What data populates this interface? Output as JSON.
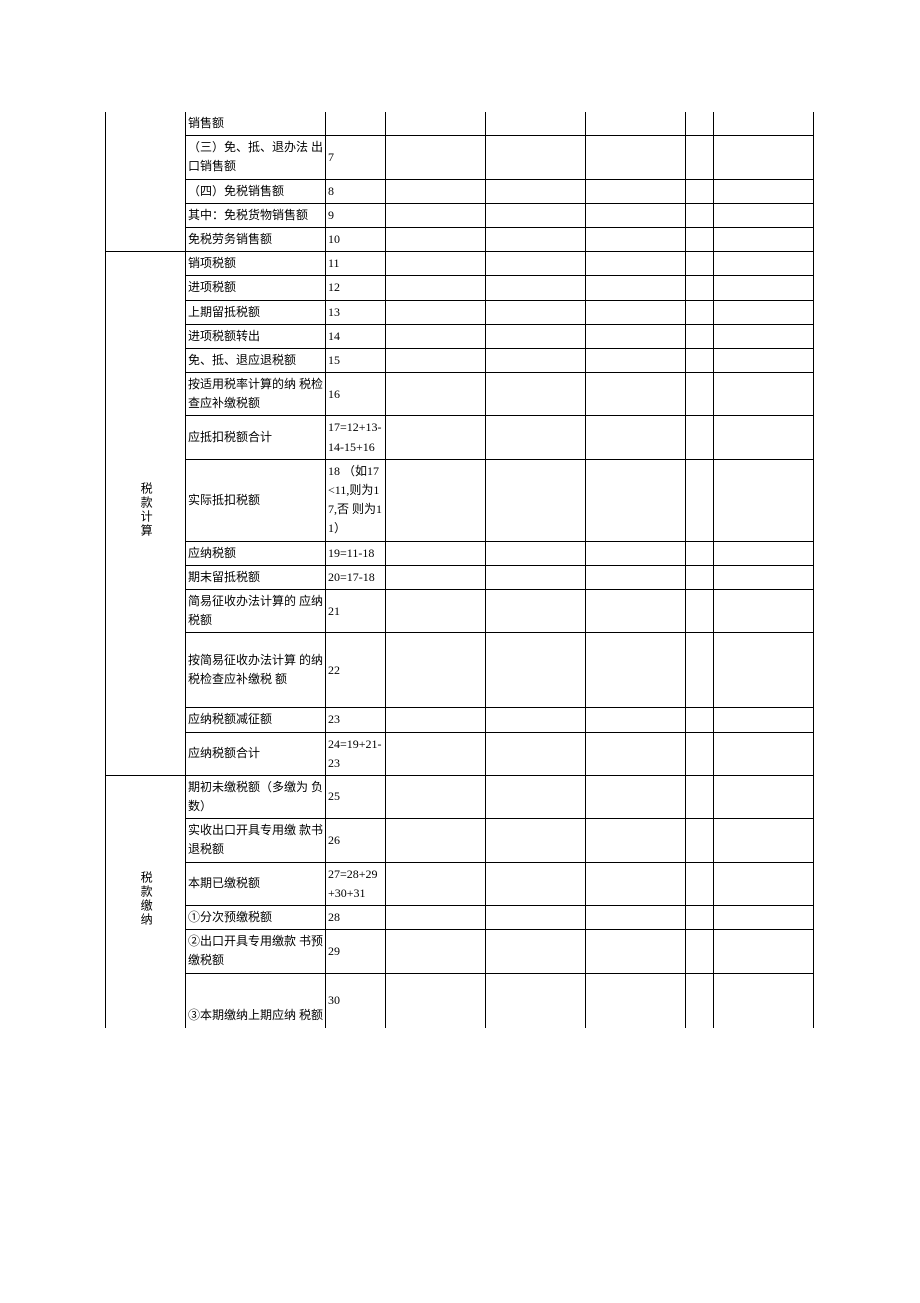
{
  "sections": {
    "top": [
      {
        "desc": "销售额",
        "num": ""
      },
      {
        "desc": " （三）免、抵、退办法 出口销售额",
        "num": "7"
      },
      {
        "desc": " （四）免税销售额",
        "num": "8"
      },
      {
        "desc": "其中：免税货物销售额",
        "num": "9"
      },
      {
        "desc": "免税劳务销售额",
        "num": "10"
      }
    ],
    "calc_label": "税款计算",
    "calc": [
      {
        "desc": "销项税额",
        "num": "11"
      },
      {
        "desc": "进项税额",
        "num": "12"
      },
      {
        "desc": "上期留抵税额",
        "num": "13"
      },
      {
        "desc": "进项税额转出",
        "num": "14"
      },
      {
        "desc": "免、抵、退应退税额",
        "num": "15"
      },
      {
        "desc": "按适用税率计算的纳 税检查应补缴税额",
        "num": "16"
      },
      {
        "desc": "应抵扣税额合计",
        "num": "17=12+13-14-15+16"
      },
      {
        "desc": "实际抵扣税额",
        "num": "18 （如17<11,则为17,否 则为11）"
      },
      {
        "desc": "应纳税额",
        "num": "19=11-18"
      },
      {
        "desc": "期末留抵税额",
        "num": "20=17-18"
      },
      {
        "desc": "简易征收办法计算的 应纳税额",
        "num": "21"
      },
      {
        "desc": "按简易征收办法计算 的纳税检查应补缴税 额",
        "num": "22"
      },
      {
        "desc": "应纳税额减征额",
        "num": "23"
      },
      {
        "desc": "应纳税额合计",
        "num": "24=19+21-23"
      }
    ],
    "pay_label": "税款缴纳",
    "pay": [
      {
        "desc": "期初未缴税额（多缴为 负数）",
        "num": "25"
      },
      {
        "desc": "实收出口开具专用缴 款书退税额",
        "num": "26"
      },
      {
        "desc": "本期已缴税额",
        "num": "27=28+29+30+31"
      },
      {
        "desc": "①分次预缴税额",
        "num": "28"
      },
      {
        "desc": "②出口开具专用缴款 书预缴税额",
        "num": "29"
      },
      {
        "desc": "③本期缴纳上期应纳 税额",
        "num": "30"
      }
    ]
  }
}
